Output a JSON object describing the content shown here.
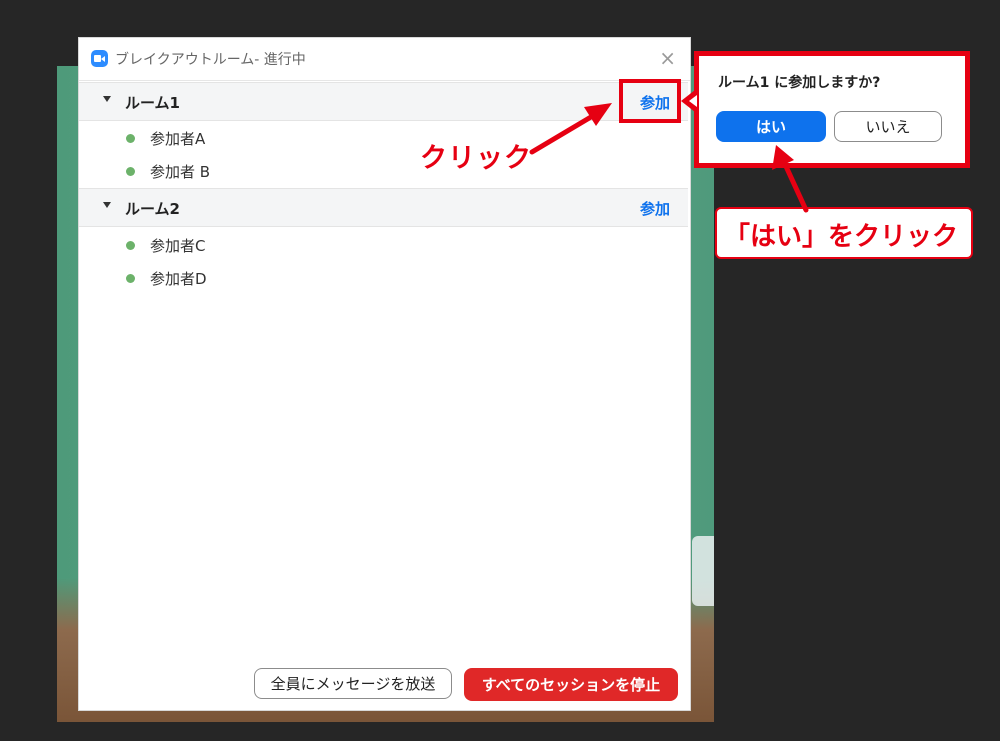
{
  "window": {
    "title": "ブレイクアウトルーム- 進行中",
    "close_icon": "×"
  },
  "rooms": [
    {
      "name": "ルーム1",
      "join_label": "参加",
      "participants": [
        "参加者A",
        "参加者 B"
      ]
    },
    {
      "name": "ルーム2",
      "join_label": "参加",
      "participants": [
        "参加者C",
        "参加者D"
      ]
    }
  ],
  "footer": {
    "broadcast_label": "全員にメッセージを放送",
    "stop_all_label": "すべてのセッションを停止"
  },
  "popup": {
    "question": "ルーム1 に参加しますか?",
    "yes_label": "はい",
    "no_label": "いいえ"
  },
  "annotations": {
    "click_note": "クリック",
    "yes_note": "「はい」をクリック"
  },
  "colors": {
    "accent_blue": "#0e72ed",
    "stop_red": "#e02828",
    "annotation_red": "#e60012",
    "participant_dot": "#6cb26a"
  }
}
